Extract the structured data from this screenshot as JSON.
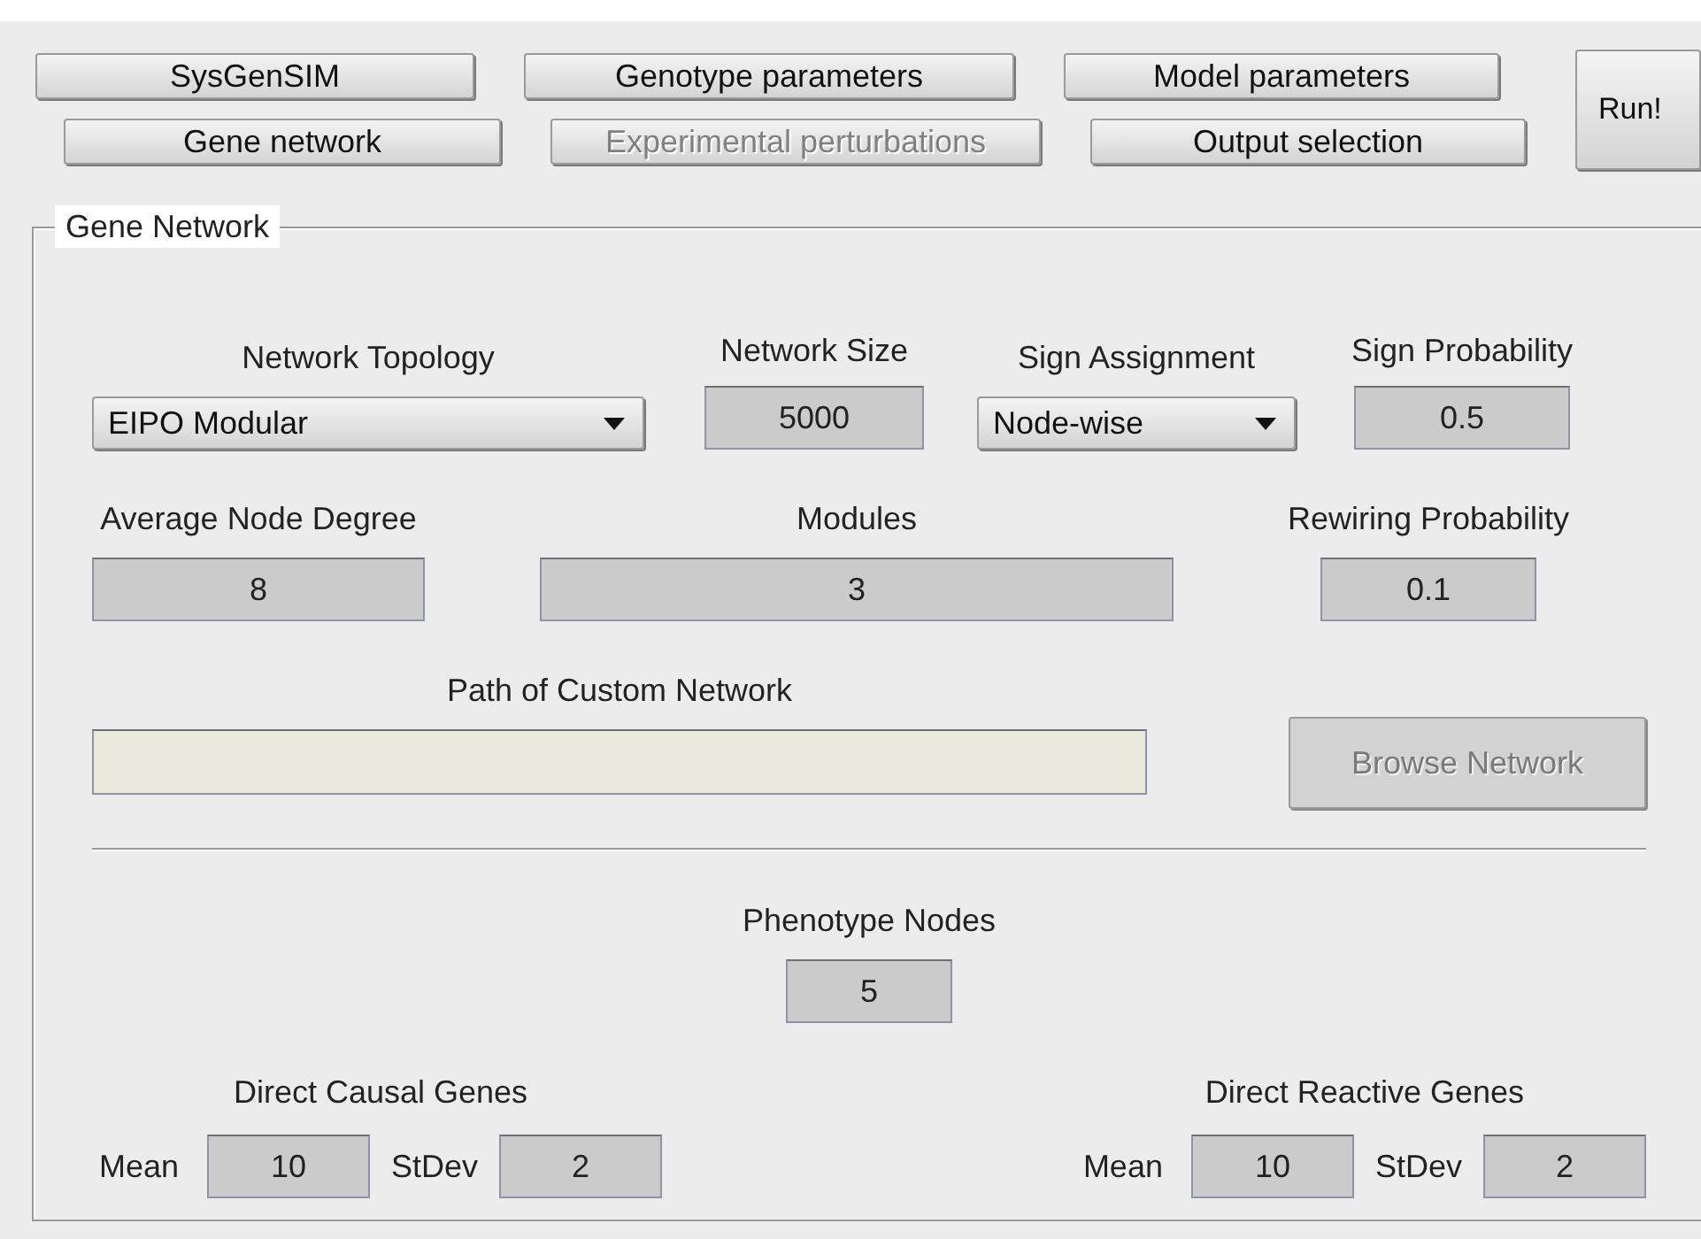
{
  "nav_buttons": [
    {
      "label": "SysGenSIM",
      "disabled": false
    },
    {
      "label": "Genotype parameters",
      "disabled": false
    },
    {
      "label": "Model parameters",
      "disabled": false
    },
    {
      "label": "Gene network",
      "disabled": false
    },
    {
      "label": "Experimental perturbations",
      "disabled": true
    },
    {
      "label": "Output selection",
      "disabled": false
    }
  ],
  "run_button": {
    "label": "Run!"
  },
  "panel": {
    "title": "Gene Network",
    "network_topology": {
      "label": "Network Topology",
      "value": "EIPO Modular"
    },
    "network_size": {
      "label": "Network Size",
      "value": "5000"
    },
    "sign_assignment": {
      "label": "Sign Assignment",
      "value": "Node-wise"
    },
    "sign_probability": {
      "label": "Sign Probability",
      "value": "0.5"
    },
    "average_node_degree": {
      "label": "Average Node Degree",
      "value": "8"
    },
    "modules": {
      "label": "Modules",
      "value": "3"
    },
    "rewiring_probability": {
      "label": "Rewiring Probability",
      "value": "0.1"
    },
    "custom_network_path": {
      "label": "Path of Custom Network"
    },
    "browse_button": {
      "label": "Browse Network",
      "disabled": true
    },
    "phenotype_nodes": {
      "label": "Phenotype Nodes",
      "value": "5"
    },
    "direct_causal_genes": {
      "label": "Direct Causal Genes",
      "mean_label": "Mean",
      "mean": "10",
      "stdev_label": "StDev",
      "stdev": "2"
    },
    "direct_reactive_genes": {
      "label": "Direct Reactive Genes",
      "mean_label": "Mean",
      "mean": "10",
      "stdev_label": "StDev",
      "stdev": "2"
    }
  }
}
